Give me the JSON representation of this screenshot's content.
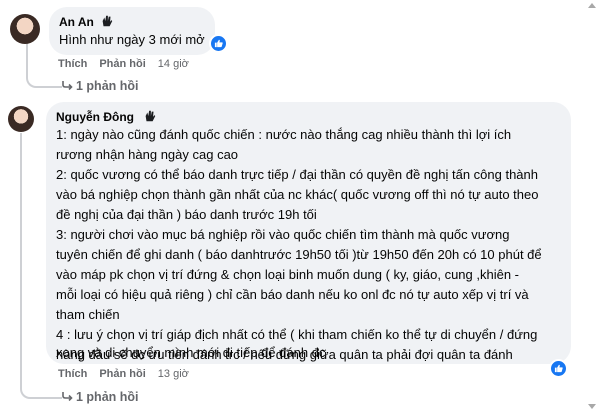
{
  "comments": [
    {
      "author": "An An",
      "lines": [
        "Hình như ngày 3 mới mở"
      ],
      "actions": {
        "like": "Thích",
        "reply": "Phản hồi",
        "time": "14 giờ"
      },
      "replies": "1 phản hồi"
    },
    {
      "author": "Nguyễn Đông",
      "lines": [
        "1: ngày nào cũng đánh quốc chiến : nước nào thắng cag nhiều thành thì lợi ích",
        "rương nhận hàng ngày cag cao",
        "2: quốc vương có thể báo danh trực tiếp / đại thần có quyền đề nghị tấn công thành",
        "vào bá nghiệp chọn thành gần nhất của nc khác( quốc vương off thì nó tự auto theo",
        "đề nghị của đại thần ) báo danh trước 19h tối",
        "3: người chơi vào mục bá nghiệp rồi vào quốc chiến tìm thành mà quốc vương",
        "tuyên chiến để ghi danh ( báo danhtrước 19h50 tối )từ 19h50 đến 20h có 10 phút để",
        "vào máp pk chọn vị trí đứng & chọn loại binh muốn dung ( ky, giáo, cung ,khiên -",
        "mỗi loại có hiệu quả riêng ) chỉ cần báo danh nếu ko onl đc nó tự auto xếp vị trí và",
        "tham chiến",
        "4 : lưu ý chọn vị trí giáp địch nhất có thể ( khi tham chiến ko thể tự di chuyển / đứng",
        "hàng đầu sẽ đc ưu tiên đánh trc / nếu đứng giữa quân ta phải đợi quân ta đánh",
        "xong và di chuyển mình mới đi tiếp để đánh đc"
      ],
      "actions": {
        "like": "Thích",
        "reply": "Phản hồi",
        "time": "13 giờ"
      },
      "replies": "1 phản hồi"
    }
  ],
  "icons": {
    "wave": "waving-hand-icon",
    "like": "thumbs-up-icon",
    "reply_arrow": "reply-arrow-icon"
  },
  "colors": {
    "bubble": "#f0f2f5",
    "text": "#050505",
    "secondary": "#65676b",
    "like_blue": "#1877f2"
  }
}
